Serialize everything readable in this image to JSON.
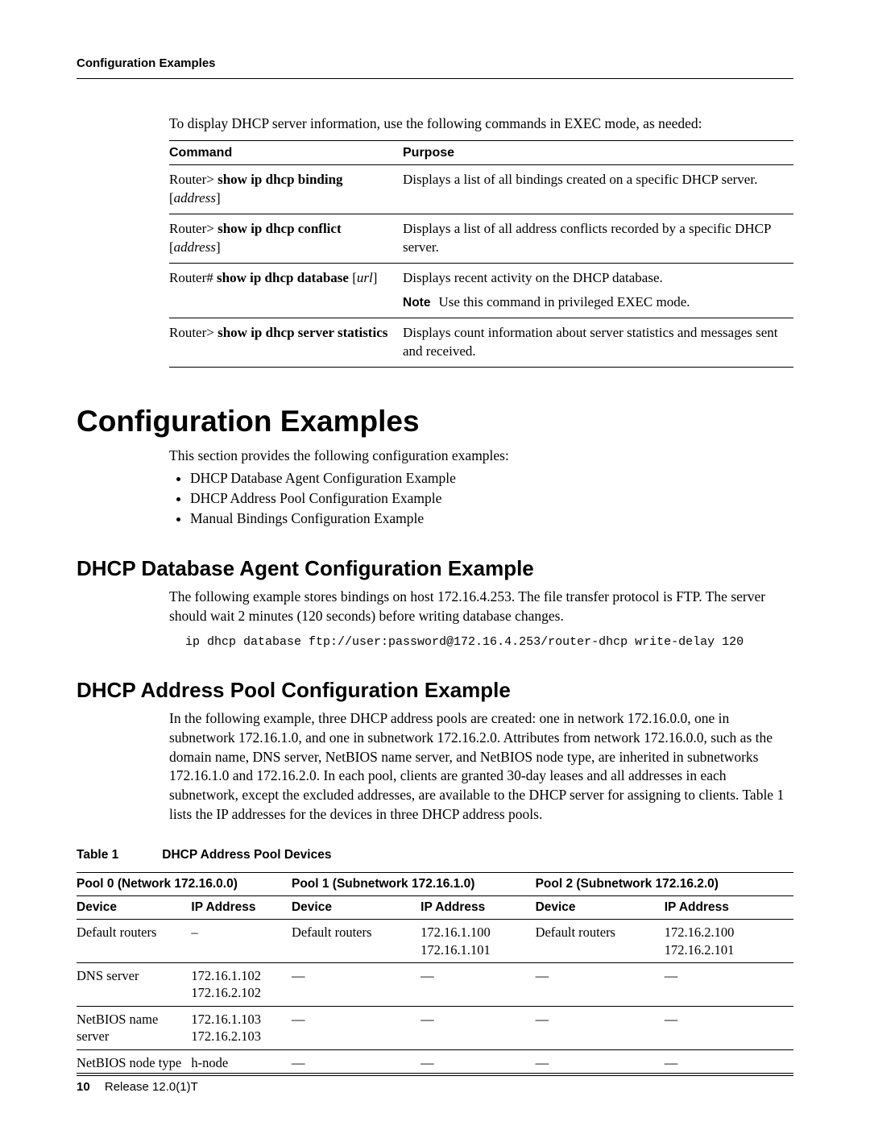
{
  "runningHeader": "Configuration Examples",
  "introLine": "To display DHCP server information, use the following commands in EXEC mode, as needed:",
  "cmdTable": {
    "head": {
      "c1": "Command",
      "c2": "Purpose"
    },
    "rows": [
      {
        "prompt": "Router> ",
        "bold": "show ip dhcp binding ",
        "ital": "address",
        "purpose": "Displays a list of all bindings created on a specific DHCP server."
      },
      {
        "prompt": "Router> ",
        "bold": "show ip dhcp conflict ",
        "ital": "address",
        "purpose": "Displays a list of all address conflicts recorded by a specific DHCP server."
      },
      {
        "prompt": "Router# ",
        "bold": "show ip dhcp database ",
        "ital": "url",
        "purpose": "Displays recent activity on the DHCP database.",
        "noteLabel": "Note",
        "noteText": "Use this command in privileged EXEC mode."
      },
      {
        "prompt": "Router> ",
        "bold": "show ip dhcp server statistics",
        "ital": "",
        "purpose": "Displays count information about server statistics and messages sent and received."
      }
    ]
  },
  "h1": "Configuration Examples",
  "overviewLine": "This section provides the following configuration examples:",
  "toc": [
    "DHCP Database Agent Configuration Example",
    "DHCP Address Pool Configuration Example",
    "Manual Bindings Configuration Example"
  ],
  "sub1": {
    "title": "DHCP Database Agent Configuration Example",
    "para": "The following example stores bindings on host 172.16.4.253. The file transfer protocol is FTP. The server should wait 2 minutes (120 seconds) before writing database changes.",
    "code": "ip dhcp database ftp://user:password@172.16.4.253/router-dhcp write-delay 120"
  },
  "sub2": {
    "title": "DHCP Address Pool Configuration Example",
    "para": "In the following example, three DHCP address pools are created: one in network 172.16.0.0, one in subnetwork 172.16.1.0, and one in subnetwork 172.16.2.0. Attributes from network 172.16.0.0, such as the domain name, DNS server, NetBIOS name server, and NetBIOS node type, are inherited in subnetworks 172.16.1.0 and 172.16.2.0. In each pool, clients are granted 30-day leases and all addresses in each subnetwork, except the excluded addresses, are available to the DHCP server for assigning to clients. Table 1 lists the IP addresses for the devices in three DHCP address pools."
  },
  "table1": {
    "captionNum": "Table 1",
    "captionTitle": "DHCP Address Pool Devices",
    "poolHeaders": [
      "Pool 0 (Network 172.16.0.0)",
      "Pool 1 (Subnetwork 172.16.1.0)",
      "Pool 2 (Subnetwork 172.16.2.0)"
    ],
    "colHeaders": [
      "Device",
      "IP Address",
      "Device",
      "IP Address",
      "Device",
      "IP Address"
    ],
    "rows": [
      [
        "Default routers",
        "–",
        "Default routers",
        "172.16.1.100\n172.16.1.101",
        "Default routers",
        "172.16.2.100\n172.16.2.101"
      ],
      [
        "DNS server",
        "172.16.1.102\n172.16.2.102",
        "—",
        "—",
        "—",
        "—"
      ],
      [
        "NetBIOS name server",
        "172.16.1.103\n172.16.2.103",
        "—",
        "—",
        "—",
        "—"
      ],
      [
        "NetBIOS node type",
        "h-node",
        "—",
        "—",
        "—",
        "—"
      ]
    ]
  },
  "footer": {
    "page": "10",
    "release": "Release 12.0(1)T"
  }
}
